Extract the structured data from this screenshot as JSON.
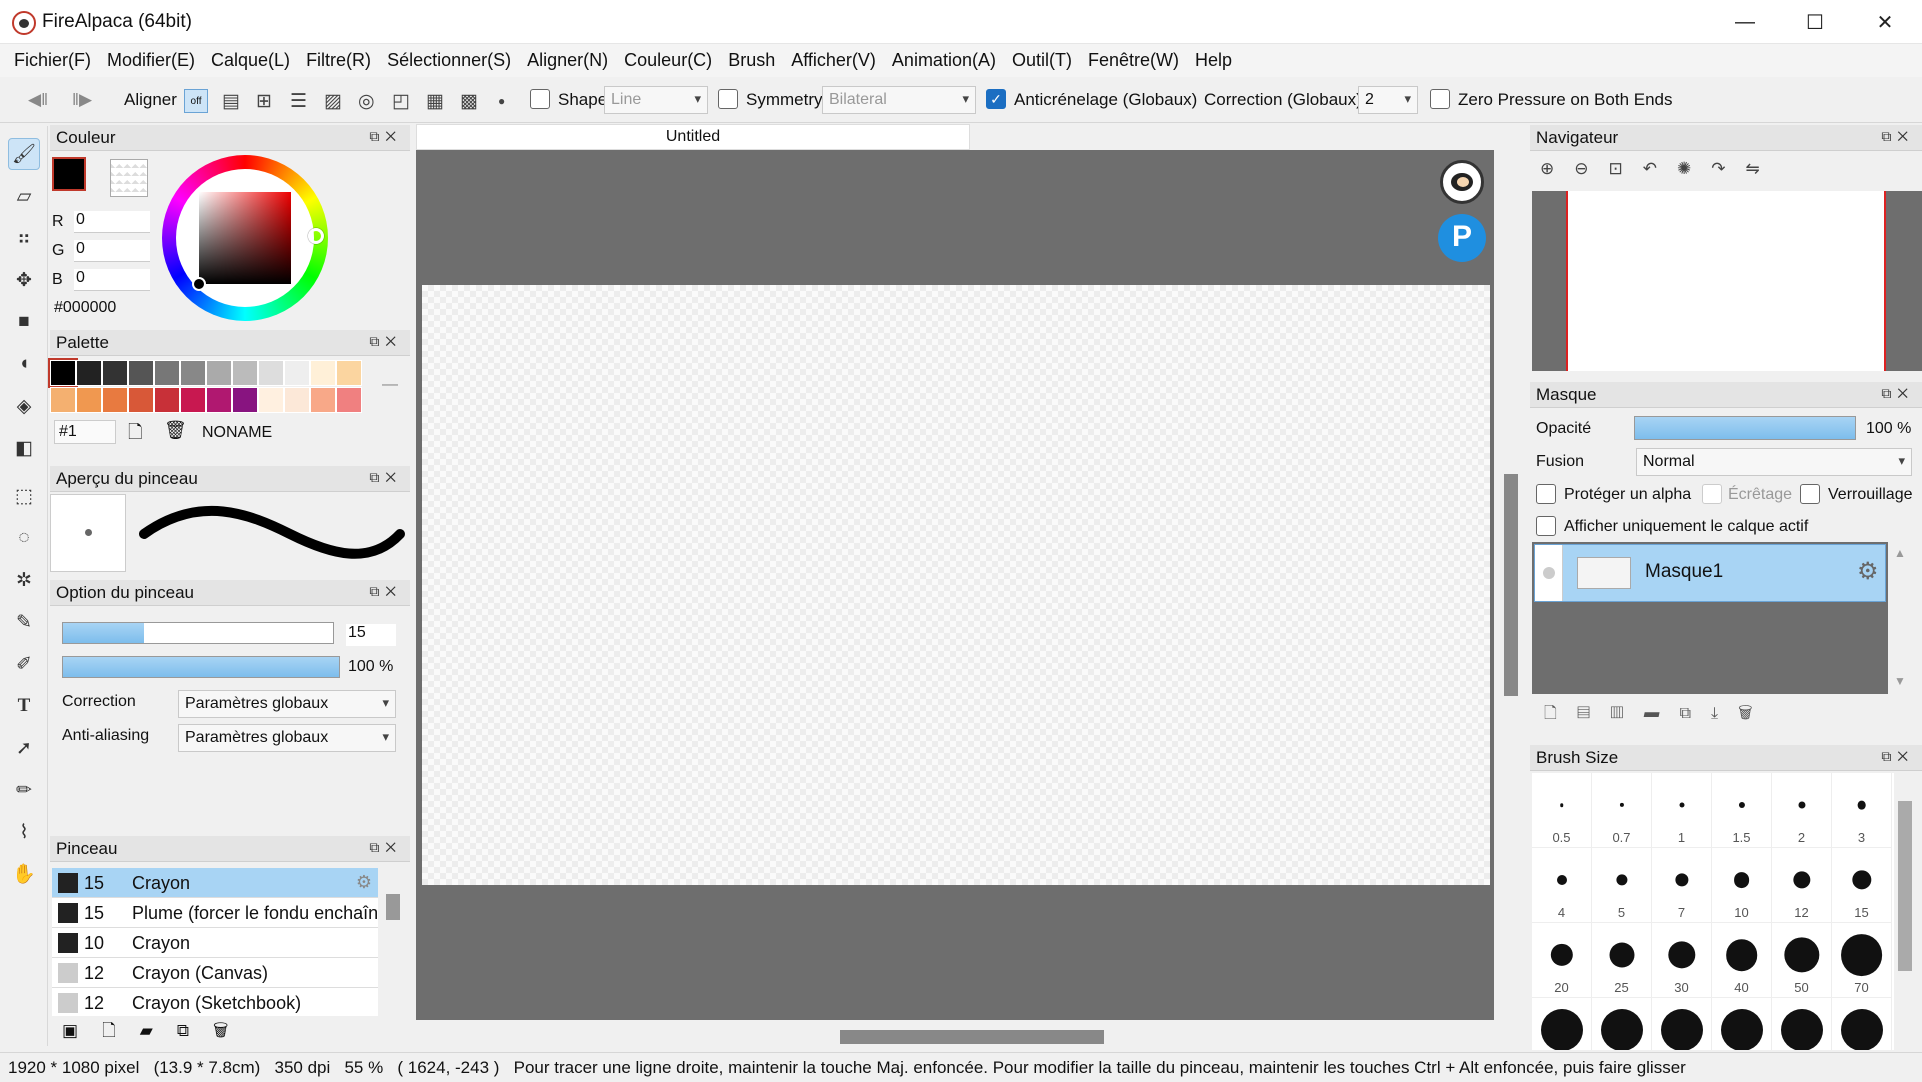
{
  "window": {
    "title": "FireAlpaca (64bit)",
    "minimize": "—",
    "maximize": "☐",
    "close": "✕"
  },
  "menu": [
    "Fichier(F)",
    "Modifier(E)",
    "Calque(L)",
    "Filtre(R)",
    "Sélectionner(S)",
    "Aligner(N)",
    "Couleur(C)",
    "Brush",
    "Afficher(V)",
    "Animation(A)",
    "Outil(T)",
    "Fenêtre(W)",
    "Help"
  ],
  "toolbar": {
    "align_label": "Aligner",
    "align_off": "off",
    "shape_label": "Shape",
    "shape_value": "Line",
    "symmetry_label": "Symmetry",
    "symmetry_value": "Bilateral",
    "antialias_label": "Anticrénelage (Globaux)",
    "correction_label": "Correction (Globaux)",
    "correction_value": "2",
    "zero_pressure_label": "Zero Pressure on Both Ends"
  },
  "color_panel": {
    "title": "Couleur",
    "r_label": "R",
    "r": "0",
    "g_label": "G",
    "g": "0",
    "b_label": "B",
    "b": "0",
    "hex": "#000000"
  },
  "palette_panel": {
    "title": "Palette",
    "index": "#1",
    "name": "NONAME",
    "row1": [
      "#000000",
      "#222222",
      "#333333",
      "#555555",
      "#777777",
      "#888888",
      "#aaaaaa",
      "#bbbbbb",
      "#dddddd",
      "#eeeeee",
      "#fff0d8",
      "#fbd5a0"
    ],
    "row2": [
      "#f4b070",
      "#f09850",
      "#e87a40",
      "#d85838",
      "#c83038",
      "#c81850",
      "#b01870",
      "#881480",
      "#fff0e0",
      "#fce8d8",
      "#f8a888",
      "#f08080"
    ]
  },
  "preview_panel": {
    "title": "Aperçu du pinceau"
  },
  "option_panel": {
    "title": "Option du pinceau",
    "size": "15",
    "size_fraction": 0.3,
    "opacity": "100 %",
    "correction_label": "Correction",
    "correction_value": "Paramètres globaux",
    "aa_label": "Anti-aliasing",
    "aa_value": "Paramètres globaux"
  },
  "brush_panel": {
    "title": "Pinceau",
    "items": [
      {
        "size": "15",
        "name": "Crayon",
        "color": "#222222",
        "selected": true
      },
      {
        "size": "15",
        "name": "Plume (forcer le fondu enchaîné)",
        "color": "#222222"
      },
      {
        "size": "10",
        "name": "Crayon",
        "color": "#222222"
      },
      {
        "size": "12",
        "name": "Crayon (Canvas)",
        "color": "#cccccc"
      },
      {
        "size": "12",
        "name": "Crayon (Sketchbook)",
        "color": "#cccccc"
      }
    ]
  },
  "document": {
    "tab": "Untitled"
  },
  "navigator_panel": {
    "title": "Navigateur"
  },
  "layer_panel": {
    "title": "Masque",
    "opacity_label": "Opacité",
    "opacity": "100 %",
    "blend_label": "Fusion",
    "blend": "Normal",
    "protect_alpha": "Protéger un alpha",
    "clipping": "Écrêtage",
    "lock": "Verrouillage",
    "active_only": "Afficher uniquement le calque actif",
    "layer_name": "Masque1"
  },
  "brushsize_panel": {
    "title": "Brush Size",
    "sizes": [
      "0.5",
      "0.7",
      "1",
      "1.5",
      "2",
      "3",
      "4",
      "5",
      "7",
      "10",
      "12",
      "15",
      "20",
      "25",
      "30",
      "40",
      "50",
      "70"
    ]
  },
  "status": {
    "dims": "1920 * 1080 pixel",
    "cm": "(13.9 * 7.8cm)",
    "dpi": "350 dpi",
    "zoom": "55 %",
    "coords": "( 1624, -243 )",
    "hint": "Pour tracer une ligne droite, maintenir la touche Maj. enfoncée. Pour modifier la taille du pinceau, maintenir les touches Ctrl + Alt enfoncée, puis faire glisser"
  }
}
